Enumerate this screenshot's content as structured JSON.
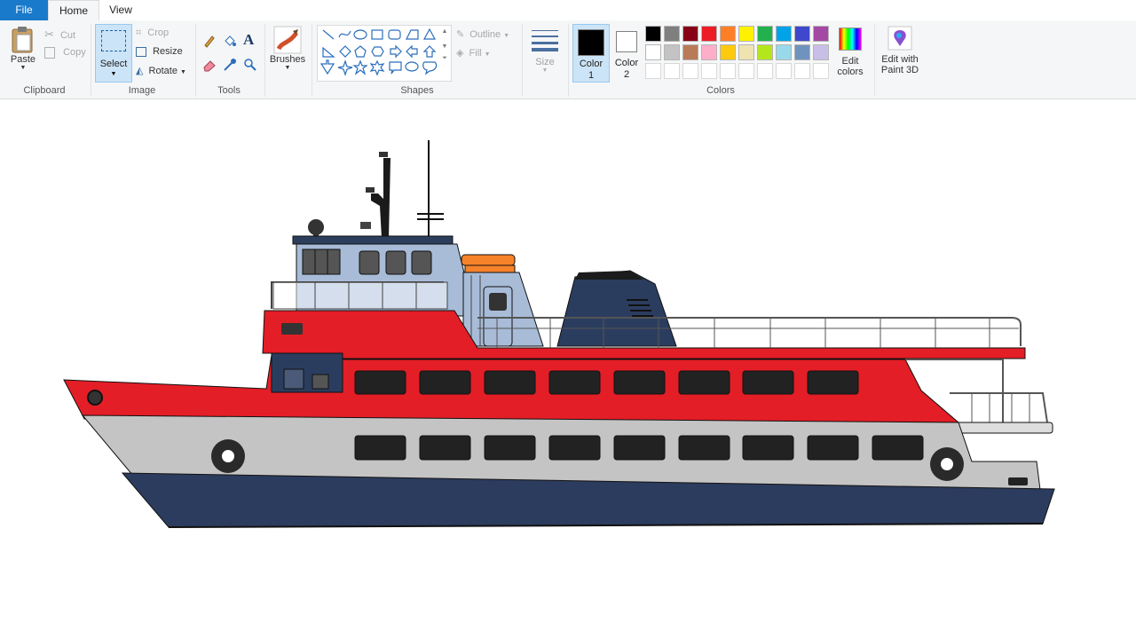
{
  "tabs": {
    "file": "File",
    "home": "Home",
    "view": "View"
  },
  "clipboard": {
    "paste": "Paste",
    "cut": "Cut",
    "copy": "Copy",
    "label": "Clipboard"
  },
  "image": {
    "select": "Select",
    "crop": "Crop",
    "resize": "Resize",
    "rotate": "Rotate",
    "label": "Image"
  },
  "tools": {
    "label": "Tools"
  },
  "brushes": {
    "label": "Brushes"
  },
  "shapes": {
    "outline": "Outline",
    "fill": "Fill",
    "label": "Shapes"
  },
  "size": {
    "label": "Size"
  },
  "colors": {
    "color1_label": "Color",
    "color1_num": "1",
    "color2_label": "Color",
    "color2_num": "2",
    "edit_colors_1": "Edit",
    "edit_colors_2": "colors",
    "paint3d_1": "Edit with",
    "paint3d_2": "Paint 3D",
    "label": "Colors",
    "palette_row1": [
      "#000000",
      "#7f7f7f",
      "#880015",
      "#ed1c24",
      "#ff7f27",
      "#fff200",
      "#22b14c",
      "#00a2e8",
      "#3f48cc",
      "#a349a4"
    ],
    "palette_row2": [
      "#ffffff",
      "#c3c3c3",
      "#b97a57",
      "#ffaec9",
      "#ffc90e",
      "#efe4b0",
      "#b5e61d",
      "#99d9ea",
      "#7092be",
      "#c8bfe7"
    ],
    "color1_value": "#000000",
    "color2_value": "#ffffff"
  }
}
